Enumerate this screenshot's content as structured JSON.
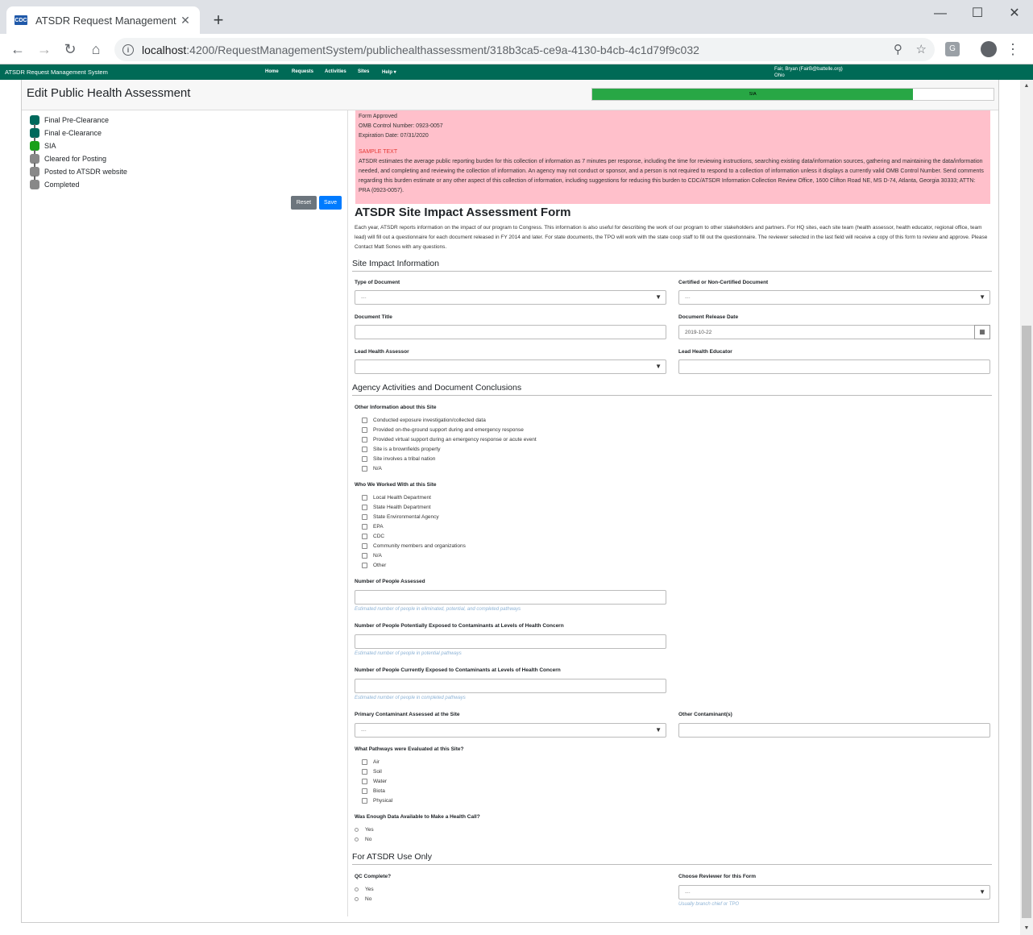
{
  "browser": {
    "tab_title": "ATSDR Request Management Sys",
    "favicon_text": "CDC",
    "url_host": "localhost",
    "url_path": ":4200/RequestManagementSystem/publichealthassessment/318b3ca5-ce9a-4130-b4cb-4c1d79f9c032"
  },
  "navbar": {
    "brand": "ATSDR Request Management System",
    "links": [
      "Home",
      "Requests",
      "Activities",
      "Sites",
      "Help ▾"
    ],
    "user_line1": "Fair, Bryan (FairB@battelle.org)",
    "user_line2": "Ohio"
  },
  "page": {
    "title": "Edit Public Health Assessment",
    "progress_label": "SIA",
    "progress_fraction": 0.8
  },
  "steps": [
    {
      "label": "Final Pre-Clearance",
      "color": "#00695c"
    },
    {
      "label": "Final e-Clearance",
      "color": "#00695c"
    },
    {
      "label": "SIA",
      "color": "#1aa01a"
    },
    {
      "label": "Cleared for Posting",
      "color": "#888888"
    },
    {
      "label": "Posted to ATSDR website",
      "color": "#888888"
    },
    {
      "label": "Completed",
      "color": "#888888"
    }
  ],
  "buttons": {
    "reset": "Reset",
    "save": "Save"
  },
  "omb": {
    "line1": "Form Approved",
    "line2": "OMB Control Number:  0923-0057",
    "line3": "Expiration Date:  07/31/2020",
    "sample": "SAMPLE TEXT",
    "burden": "ATSDR estimates the average public reporting burden for this collection of information as 7 minutes per response, including the time for reviewing instructions, searching existing data/information sources, gathering and maintaining the data/information needed, and completing and reviewing the collection of information. An agency may not conduct or sponsor, and a person is not required to respond to a collection of information unless it displays a currently valid OMB Control Number. Send comments regarding this burden estimate or any other aspect of this collection of information, including suggestions for reducing this burden to CDC/ATSDR Information Collection Review Office, 1600 Clifton Road NE, MS D-74, Atlanta, Georgia 30333; ATTN: PRA (0923-0057)."
  },
  "form": {
    "title": "ATSDR Site Impact Assessment Form",
    "intro": "Each year, ATSDR reports information on the impact of our program to Congress. This information is also useful for describing the work of our program to other stakeholders and partners. For HQ sites, each site team (health assessor, health educator, regional office, team lead) will fill out a questionnaire for each document released in FY 2014 and later. For state documents, the TPO will work with the state coop staff to fill out the questionnaire. The reviewer selected in the last field will receive a copy of this form to review and approve. Please Contact Matt Sones with any questions.",
    "section1": "Site Impact Information",
    "type_of_document": {
      "label": "Type of Document",
      "value": "---"
    },
    "certified": {
      "label": "Certified or Non-Certified Document",
      "value": "---"
    },
    "document_title": {
      "label": "Document Title",
      "value": ""
    },
    "release_date": {
      "label": "Document Release Date",
      "value": "2019-10-22"
    },
    "lead_assessor": {
      "label": "Lead Health Assessor",
      "value": ""
    },
    "lead_educator": {
      "label": "Lead Health Educator",
      "value": ""
    },
    "section2": "Agency Activities and Document Conclusions",
    "other_info": {
      "label": "Other Information about this Site",
      "options": [
        "Conducted exposure investigation/collected data",
        "Provided on-the-ground support during and emergency response",
        "Provided virtual support during an emergency response or acute event",
        "Site is a brownfields property",
        "Site involves a tribal nation",
        "N/A"
      ]
    },
    "worked_with": {
      "label": "Who We Worked With at this Site",
      "options": [
        "Local Health Department",
        "State Health Department",
        "State Environmental Agency",
        "EPA",
        "CDC",
        "Community members and organizations",
        "N/A",
        "Other"
      ]
    },
    "people_assessed": {
      "label": "Number of People Assessed",
      "hint": "Estimated number of people in eliminated, potential, and completed pathways"
    },
    "people_potential": {
      "label": "Number of People Potentially Exposed to Contaminants at Levels of Health Concern",
      "hint": "Estimated number of people in potential pathways"
    },
    "people_current": {
      "label": "Number of People Currently Exposed to Contaminants at Levels of Health Concern",
      "hint": "Estimated number of people in completed pathways"
    },
    "primary_contaminant": {
      "label": "Primary Contaminant Assessed at the Site",
      "value": "---"
    },
    "other_contaminant": {
      "label": "Other Contaminant(s)"
    },
    "pathways": {
      "label": "What Pathways were Evaluated at this Site?",
      "options": [
        "Air",
        "Soil",
        "Water",
        "Biota",
        "Physical"
      ]
    },
    "enough_data": {
      "label": "Was Enough Data Available to Make a Health Call?",
      "options": [
        "Yes",
        "No"
      ]
    },
    "section3": "For ATSDR Use Only",
    "qc": {
      "label": "QC Complete?",
      "options": [
        "Yes",
        "No"
      ]
    },
    "reviewer": {
      "label": "Choose Reviewer for this Form",
      "value": "---",
      "hint": "Usually branch chief or TPO"
    }
  }
}
